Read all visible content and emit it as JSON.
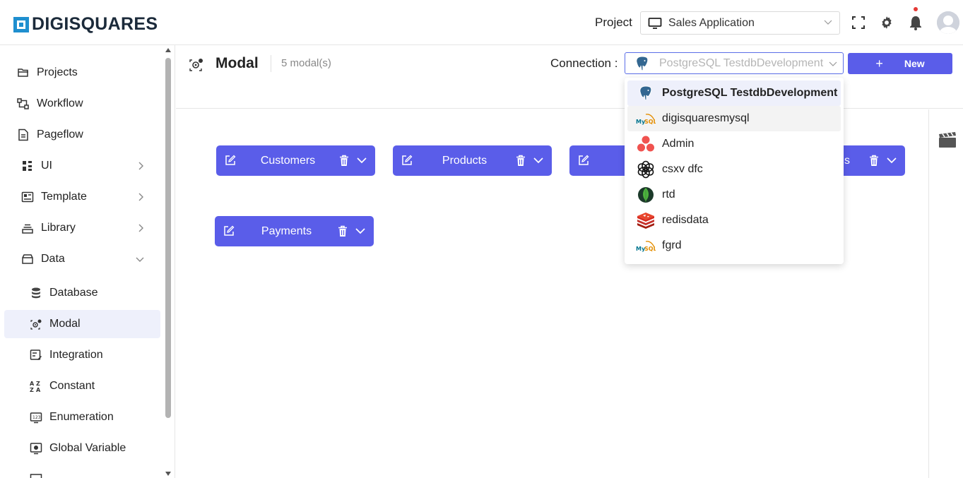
{
  "header": {
    "logo_text": "DIGISQUARES",
    "project_label": "Project",
    "project_value": "Sales Application"
  },
  "sidebar": {
    "items": [
      {
        "label": "Projects",
        "icon": "folder-open-icon"
      },
      {
        "label": "Workflow",
        "icon": "workflow-icon"
      },
      {
        "label": "Pageflow",
        "icon": "page-icon"
      },
      {
        "label": "UI",
        "icon": "ui-grid-icon",
        "has_arrow": true
      },
      {
        "label": "Template",
        "icon": "template-icon",
        "has_arrow": true
      },
      {
        "label": "Library",
        "icon": "library-icon",
        "has_arrow": true
      },
      {
        "label": "Data",
        "icon": "data-icon",
        "expanded": true
      },
      {
        "label": "Database",
        "icon": "database-icon"
      },
      {
        "label": "Modal",
        "icon": "modal-icon",
        "active": true
      },
      {
        "label": "Integration",
        "icon": "integration-icon"
      },
      {
        "label": "Constant",
        "icon": "constant-icon"
      },
      {
        "label": "Enumeration",
        "icon": "enumeration-icon"
      },
      {
        "label": "Global Variable",
        "icon": "global-variable-icon"
      }
    ]
  },
  "main": {
    "title": "Modal",
    "count": "5 modal(s)",
    "connection_label": "Connection :",
    "connection_value": "PostgreSQL TestdbDevelopment",
    "new_button": "New",
    "modals": [
      {
        "name": "Customers"
      },
      {
        "name": "Products"
      },
      {
        "name": ""
      },
      {
        "name": "s"
      },
      {
        "name": "Payments"
      }
    ]
  },
  "dropdown": {
    "options": [
      {
        "label": "PostgreSQL TestdbDevelopment",
        "icon": "postgresql-icon",
        "selected": true
      },
      {
        "label": "digisquaresmysql",
        "icon": "mysql-icon"
      },
      {
        "label": "Admin",
        "icon": "admin-dots-icon"
      },
      {
        "label": "csxv dfc",
        "icon": "openai-icon"
      },
      {
        "label": "rtd",
        "icon": "mongodb-icon"
      },
      {
        "label": "redisdata",
        "icon": "redis-icon"
      },
      {
        "label": "fgrd",
        "icon": "mysql-icon"
      }
    ]
  },
  "colors": {
    "accent": "#5a5de9",
    "active_bg": "#eef0fb",
    "notification": "#e53935"
  }
}
